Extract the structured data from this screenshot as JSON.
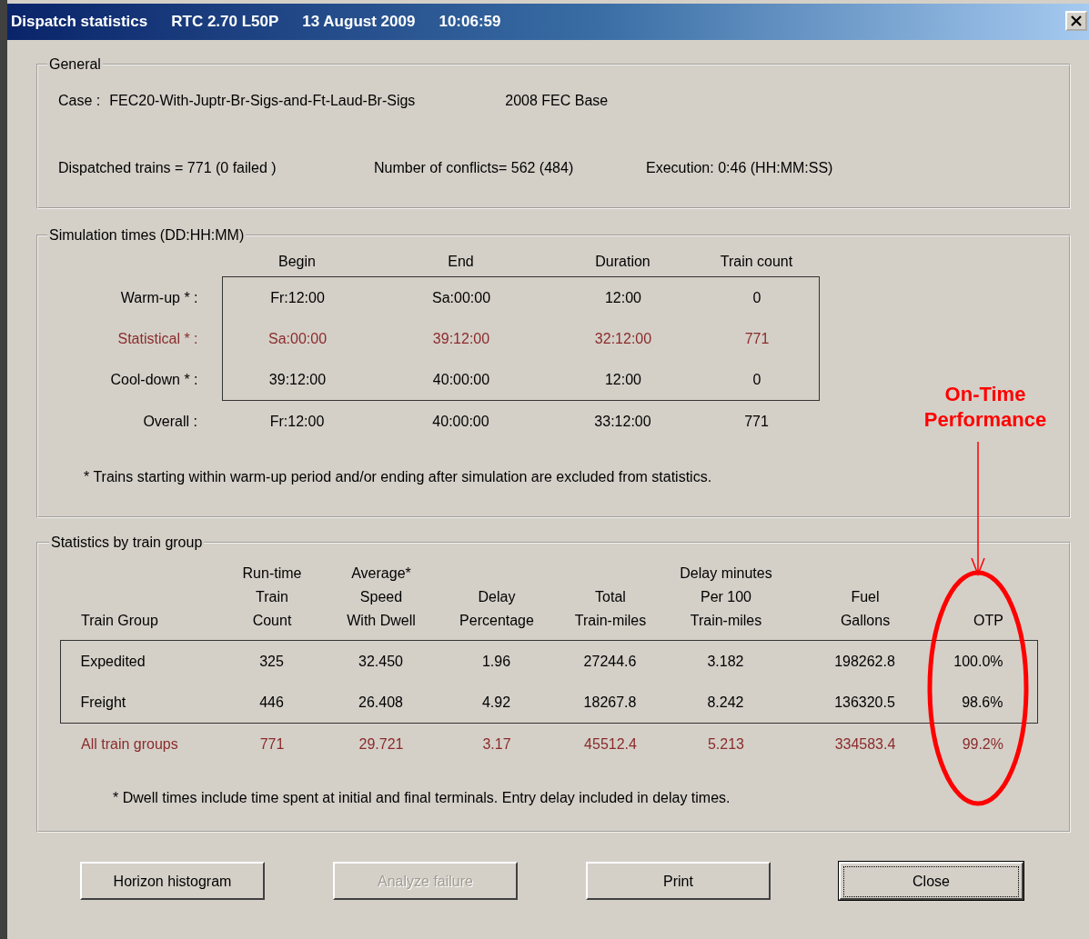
{
  "window": {
    "title_parts": [
      "Dispatch statistics",
      "RTC  2.70 L50P",
      "13 August 2009",
      "10:06:59"
    ]
  },
  "general": {
    "title": "General",
    "case_label": "Case :",
    "case_value": "FEC20-With-Juptr-Br-Sigs-and-Ft-Laud-Br-Sigs",
    "base": "2008 FEC Base",
    "stats": [
      "Dispatched trains = 771 (0 failed )",
      "Number of conflicts= 562 (484)",
      "Execution: 0:46 (HH:MM:SS)"
    ]
  },
  "simulation": {
    "title": "Simulation times (DD:HH:MM)",
    "columns": [
      "Begin",
      "End",
      "Duration",
      "Train count"
    ],
    "period_rows": [
      {
        "label": "Warm-up * :",
        "values": [
          "Fr:12:00",
          "Sa:00:00",
          "12:00",
          "0"
        ],
        "highlighted": false
      },
      {
        "label": "Statistical * :",
        "values": [
          "Sa:00:00",
          "39:12:00",
          "32:12:00",
          "771"
        ],
        "highlighted": true
      },
      {
        "label": "Cool-down * :",
        "values": [
          "39:12:00",
          "40:00:00",
          "12:00",
          "0"
        ],
        "highlighted": false
      }
    ],
    "overall_row": {
      "label": "Overall :",
      "values": [
        "Fr:12:00",
        "40:00:00",
        "33:12:00",
        "771"
      ],
      "highlighted": false
    },
    "note": "* Trains starting within warm-up period and/or ending after simulation are excluded from statistics."
  },
  "statistics": {
    "title": "Statistics by train group",
    "columns": [
      {
        "lines": [
          "Train Group"
        ]
      },
      {
        "lines": [
          "Run-time",
          "Train",
          "Count"
        ]
      },
      {
        "lines": [
          "Average*",
          "Speed",
          "With Dwell"
        ]
      },
      {
        "lines": [
          "Delay",
          "Percentage"
        ]
      },
      {
        "lines": [
          "Total",
          "Train-miles"
        ]
      },
      {
        "lines": [
          "Delay minutes",
          "Per 100",
          "Train-miles"
        ]
      },
      {
        "lines": [
          "Fuel",
          "Gallons"
        ]
      },
      {
        "lines": [
          "OTP"
        ]
      }
    ],
    "group_rows": [
      {
        "cells": [
          "Expedited",
          "325",
          "32.450",
          "1.96",
          "27244.6",
          "3.182",
          "198262.8",
          "100.0%"
        ],
        "highlighted": false
      },
      {
        "cells": [
          "Freight",
          "446",
          "26.408",
          "4.92",
          "18267.8",
          "8.242",
          "136320.5",
          "98.6%"
        ],
        "highlighted": false
      }
    ],
    "total_row": {
      "cells": [
        "All train groups",
        "771",
        "29.721",
        "3.17",
        "45512.4",
        "5.213",
        "334583.4",
        "99.2%"
      ],
      "highlighted": true
    },
    "note": "* Dwell times include time spent at initial and final terminals.   Entry delay included in delay times."
  },
  "annotation": {
    "text": "On-Time Performance"
  },
  "buttons": [
    {
      "label": "Horizon histogram",
      "disabled": false,
      "focused": false
    },
    {
      "label": "Analyze failure",
      "disabled": true,
      "focused": false
    },
    {
      "label": "Print",
      "disabled": false,
      "focused": false
    },
    {
      "label": "Close",
      "disabled": false,
      "focused": true
    }
  ]
}
